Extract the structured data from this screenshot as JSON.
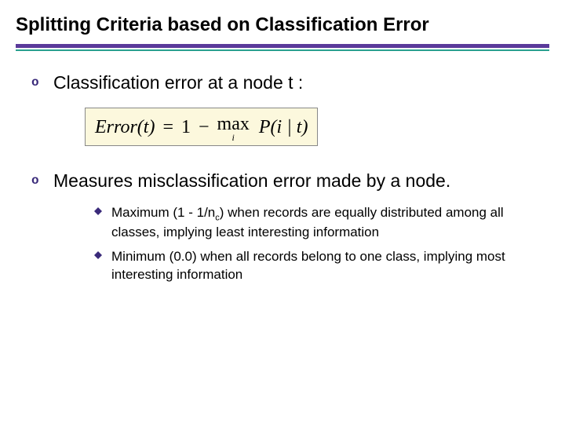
{
  "title": "Splitting Criteria based on Classification Error",
  "points": {
    "p1": "Classification error at a node t :",
    "p2": "Measures misclassification error made by a node."
  },
  "formula": {
    "lhs": "Error(t)",
    "eq": "=",
    "one": "1",
    "minus": "−",
    "max": "max",
    "max_sub": "i",
    "prob": "P(i | t)"
  },
  "subpoints": {
    "s1a": "Maximum (1 - 1/n",
    "s1sub": "c",
    "s1b": ") when records are equally distributed among all classes, implying least interesting information",
    "s2": "Minimum (0.0) when all records belong to one class, implying most interesting information"
  }
}
